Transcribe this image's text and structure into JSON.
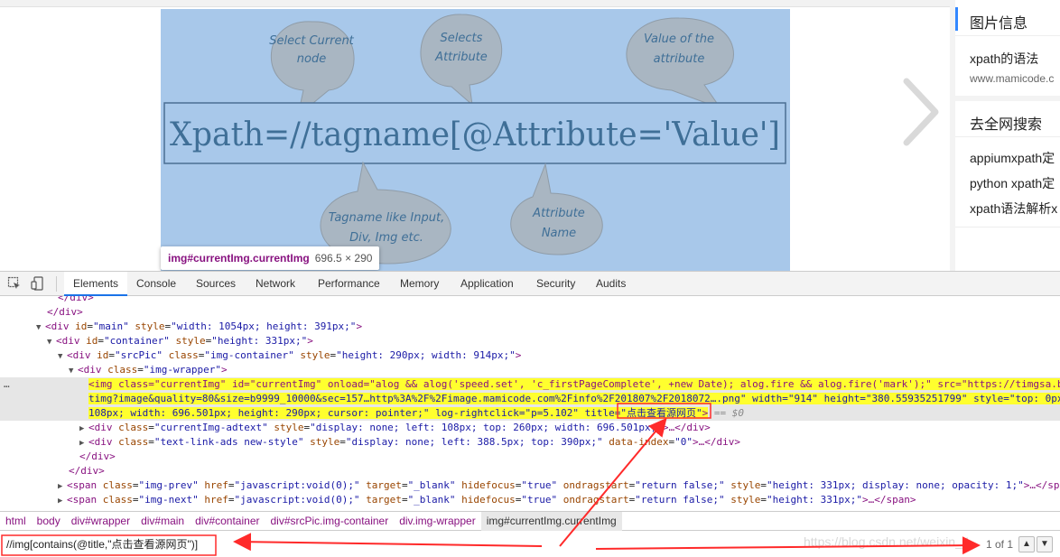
{
  "diagram": {
    "expression": "Xpath=//tagname[@Attribute='Value']",
    "bubbles": [
      {
        "line1": "Select Current",
        "line2": "node"
      },
      {
        "line1": "Selects",
        "line2": "Attribute"
      },
      {
        "line1": "Value of the",
        "line2": "attribute"
      },
      {
        "line1": "Tagname like Input,",
        "line2": "Div, Img etc."
      },
      {
        "line1": "Attribute",
        "line2": "Name"
      }
    ],
    "colors": {
      "background": "#a8c8ea",
      "bubble": "#a9b6c2",
      "text": "#3f6f97"
    }
  },
  "tooltip": {
    "selector": "img#currentImg.currentImg",
    "dimensions": "696.5 × 290"
  },
  "sidebar": {
    "section1_title": "图片信息",
    "item_title": "xpath的语法",
    "item_url": "www.mamicode.c",
    "section2_title": "去全网搜索",
    "links": [
      "appiumxpath定",
      "python xpath定",
      "xpath语法解析x"
    ]
  },
  "devtools": {
    "icons": [
      "inspect-icon",
      "device-toggle-icon"
    ],
    "tabs": [
      "Elements",
      "Console",
      "Sources",
      "Network",
      "Performance",
      "Memory",
      "Application",
      "Security",
      "Audits"
    ],
    "active_tab": "Elements",
    "dom_lines": {
      "l0": "</div>",
      "l1": "</div>",
      "l2_tag_open": "<div",
      "l2_attr1": "id",
      "l2_val1": "\"main\"",
      "l2_attr2": "style",
      "l2_val2": "\"width: 1054px; height: 391px;\"",
      "l3_attr1": "id",
      "l3_val1": "\"container\"",
      "l3_attr2": "style",
      "l3_val2": "\"height: 331px;\"",
      "l4_attr1": "id",
      "l4_val1": "\"srcPic\"",
      "l4_attr2": "class",
      "l4_val2": "\"img-container\"",
      "l4_attr3": "style",
      "l4_val3": "\"height: 290px; width: 914px;\"",
      "l5_attr1": "class",
      "l5_val1": "\"img-wrapper\"",
      "l6": "<img class=\"currentImg\" id=\"currentImg\" onload=\"alog && alog('speed.set', 'c_firstPageComplete', +new Date); alog.fire && alog.fire('mark');\" src=\"https://timgsa.b",
      "l7": "timg?image&quality=80&size=b9999_10000&sec=157…http%3A%2F%2Fimage.mamicode.com%2Finfo%2F201807%2F2018072….png\" width=\"914\" height=\"380.55935251799\" style=\"top: 0px",
      "l8_pre": "108px; width: 696.501px; height: 290px; cursor: pointer;\" log-rightclick=\"p=5.102\" title=",
      "l8_title": "\"点击查看源网页\"",
      "l8_tail": ">",
      "l8_eq": "== $0",
      "l9_attr1": "class",
      "l9_val1": "\"currentImg-adtext\"",
      "l9_attr2": "style",
      "l9_val2": "\"display: none; left: 108px; top: 260px; width: 696.501px;\"",
      "l9_tail": ">…</div>",
      "l10_attr1": "class",
      "l10_val1": "\"text-link-ads new-style\"",
      "l10_attr2": "style",
      "l10_val2": "\"display: none; left: 388.5px; top: 390px;\"",
      "l10_attr3": "data-index",
      "l10_val3": "\"0\"",
      "l10_tail": ">…</div>",
      "l11": "</div>",
      "l12": "</div>",
      "l13_attr1": "class",
      "l13_val1": "\"img-prev\"",
      "l13_attr2": "href",
      "l13_val2": "\"javascript:void(0);\"",
      "l13_attr3": "target",
      "l13_val3": "\"_blank\"",
      "l13_attr4": "hidefocus",
      "l13_val4": "\"true\"",
      "l13_attr5": "ondragstart",
      "l13_val5": "\"return false;\"",
      "l13_attr6": "style",
      "l13_val6": "\"height: 331px; display: none; opacity: 1;\"",
      "l13_tail": ">…</span>",
      "l14_attr1": "class",
      "l14_val1": "\"img-next\"",
      "l14_attr2": "href",
      "l14_val2": "\"javascript:void(0);\"",
      "l14_attr3": "target",
      "l14_val3": "\"_blank\"",
      "l14_attr4": "hidefocus",
      "l14_val4": "\"true\"",
      "l14_attr5": "ondragstart",
      "l14_val5": "\"return false;\"",
      "l14_attr6": "style",
      "l14_val6": "\"height: 331px;\"",
      "l14_tail": ">…</span>",
      "tag_div": "div",
      "tag_span": "span",
      "lt": "<",
      "gt": ">",
      "ellipsis": "…"
    },
    "breadcrumbs": [
      "html",
      "body",
      "div#wrapper",
      "div#main",
      "div#container",
      "div#srcPic.img-container",
      "div.img-wrapper",
      "img#currentImg.currentImg"
    ],
    "search": {
      "value": "//img[contains(@title,\"点击查看源网页\")]",
      "match_count": "1 of 1",
      "watermark": "https://blog.csdn.net/weixin_4..."
    },
    "colors": {
      "tag": "#881280",
      "attr_name": "#994500",
      "attr_value": "#1a1aa6",
      "highlight": "#ffff2e",
      "annotation": "#ff2a2a"
    }
  }
}
